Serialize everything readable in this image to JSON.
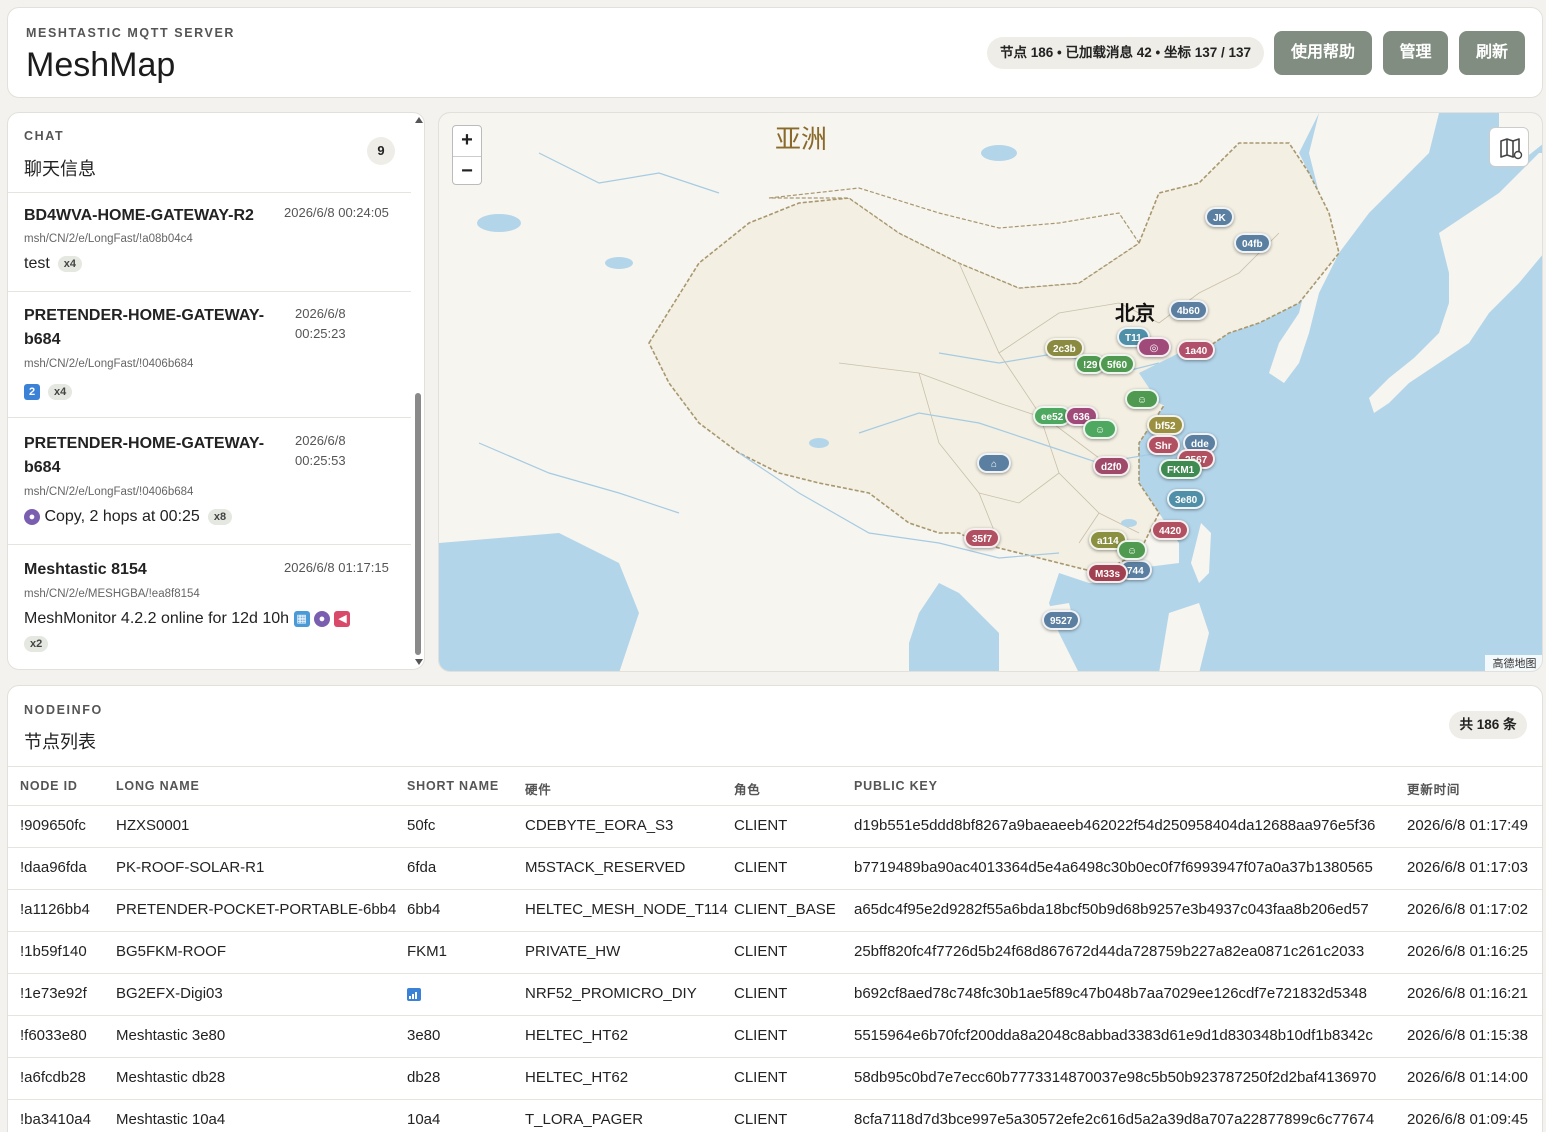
{
  "header": {
    "eyebrow": "MESHTASTIC MQTT SERVER",
    "title": "MeshMap",
    "stats": "节点 186 • 已加载消息 42 • 坐标 137 / 137",
    "help_label": "使用帮助",
    "admin_label": "管理",
    "refresh_label": "刷新"
  },
  "chat": {
    "eyebrow": "CHAT",
    "title": "聊天信息",
    "count": "9",
    "messages": [
      {
        "sender": "BD4WVA-HOME-GATEWAY-R2",
        "time": "2026/6/8 00:24:05",
        "topic": "msh/CN/2/e/LongFast/!a08b04c4",
        "text": "test",
        "badge": "x4"
      },
      {
        "sender": "PRETENDER-HOME-GATEWAY-b684",
        "time": "2026/6/8 00:25:23",
        "topic": "msh/CN/2/e/LongFast/!0406b684",
        "text": "2",
        "badge": "x4"
      },
      {
        "sender": "PRETENDER-HOME-GATEWAY-b684",
        "time": "2026/6/8 00:25:53",
        "topic": "msh/CN/2/e/LongFast/!0406b684",
        "text": "Copy, 2 hops at 00:25",
        "badge": "x8"
      },
      {
        "sender": "Meshtastic 8154",
        "time": "2026/6/8 01:17:15",
        "topic": "msh/CN/2/e/MESHGBA/!ea8f8154",
        "text": "MeshMonitor 4.2.2 online for 12d 10h",
        "badge": "x2"
      }
    ]
  },
  "map": {
    "region_label": "亚洲",
    "city_label": "北京",
    "attribution": "高德地图",
    "zoom_in": "+",
    "zoom_out": "−",
    "pins": [
      {
        "label": "JK",
        "color": "#5b7fa0"
      },
      {
        "label": "04fb",
        "color": "#5b7fa0"
      },
      {
        "label": "4b60",
        "color": "#5b7fa0"
      },
      {
        "label": "T11",
        "color": "#4f8fa8"
      },
      {
        "label": "1a40",
        "color": "#b0506a"
      },
      {
        "label": "2c3b",
        "color": "#8a8a40"
      },
      {
        "label": "!29",
        "color": "#4f9a50"
      },
      {
        "label": "5f60",
        "color": "#4f9a50"
      },
      {
        "label": "ee52",
        "color": "#4fa860"
      },
      {
        "label": "636",
        "color": "#a04a7a"
      },
      {
        "label": "bf52",
        "color": "#9a9040"
      },
      {
        "label": "Shr",
        "color": "#b05060"
      },
      {
        "label": "dde",
        "color": "#5b7fa0"
      },
      {
        "label": "2567",
        "color": "#b05060"
      },
      {
        "label": "FKM1",
        "color": "#3f8a50"
      },
      {
        "label": "d2f0",
        "color": "#a04a6a"
      },
      {
        "label": "3e80",
        "color": "#4f8fa8"
      },
      {
        "label": "4420",
        "color": "#b05060"
      },
      {
        "label": "a114",
        "color": "#8a9040"
      },
      {
        "label": "744",
        "color": "#5b7fa0"
      },
      {
        "label": "M33s",
        "color": "#a04050"
      },
      {
        "label": "35f7",
        "color": "#b05060"
      },
      {
        "label": "9527",
        "color": "#5b7fa0"
      }
    ]
  },
  "nodes": {
    "eyebrow": "NODEINFO",
    "title": "节点列表",
    "total": "共 186 条",
    "columns": [
      "NODE ID",
      "LONG NAME",
      "SHORT NAME",
      "硬件",
      "角色",
      "PUBLIC KEY",
      "更新时间"
    ],
    "rows": [
      [
        "!909650fc",
        "HZXS0001",
        "50fc",
        "CDEBYTE_EORA_S3",
        "CLIENT",
        "d19b551e5ddd8bf8267a9baeaeeb462022f54d250958404da12688aa976e5f36",
        "2026/6/8 01:17:49"
      ],
      [
        "!daa96fda",
        "PK-ROOF-SOLAR-R1",
        "6fda",
        "M5STACK_RESERVED",
        "CLIENT",
        "b7719489ba90ac4013364d5e4a6498c30b0ec0f7f6993947f07a0a37b1380565",
        "2026/6/8 01:17:03"
      ],
      [
        "!a1126bb4",
        "PRETENDER-POCKET-PORTABLE-6bb4",
        "6bb4",
        "HELTEC_MESH_NODE_T114",
        "CLIENT_BASE",
        "a65dc4f95e2d9282f55a6bda18bcf50b9d68b9257e3b4937c043faa8b206ed57",
        "2026/6/8 01:17:02"
      ],
      [
        "!1b59f140",
        "BG5FKM-ROOF",
        "FKM1",
        "PRIVATE_HW",
        "CLIENT",
        "25bff820fc4f7726d5b24f68d867672d44da728759b227a82ea0871c261c2033",
        "2026/6/8 01:16:25"
      ],
      [
        "!1e73e92f",
        "BG2EFX-Digi03",
        "",
        "NRF52_PROMICRO_DIY",
        "CLIENT",
        "b692cf8aed78c748fc30b1ae5f89c47b048b7aa7029ee126cdf7e721832d5348",
        "2026/6/8 01:16:21"
      ],
      [
        "!f6033e80",
        "Meshtastic 3e80",
        "3e80",
        "HELTEC_HT62",
        "CLIENT",
        "5515964e6b70fcf200dda8a2048c8abbad3383d61e9d1d830348b10df1b8342c",
        "2026/6/8 01:15:38"
      ],
      [
        "!a6fcdb28",
        "Meshtastic db28",
        "db28",
        "HELTEC_HT62",
        "CLIENT",
        "58db95c0bd7e7ecc60b7773314870037e98c5b50b923787250f2d2baf4136970",
        "2026/6/8 01:14:00"
      ],
      [
        "!ba3410a4",
        "Meshtastic 10a4",
        "10a4",
        "T_LORA_PAGER",
        "CLIENT",
        "8cfa7118d7d3bce997e5a30572efe2c616d5a2a39d8a707a22877899c6c77674",
        "2026/6/8 01:09:45"
      ]
    ]
  }
}
